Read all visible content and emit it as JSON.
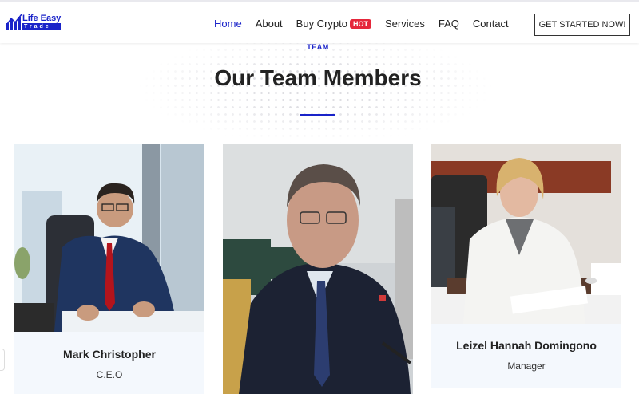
{
  "brand": {
    "line1": "Life Easy",
    "line2": "Trade",
    "color": "#1a23c9"
  },
  "nav": {
    "items": [
      {
        "label": "Home",
        "active": true
      },
      {
        "label": "About",
        "active": false
      },
      {
        "label": "Buy Crypto",
        "active": false,
        "badge": "HOT"
      },
      {
        "label": "Services",
        "active": false
      },
      {
        "label": "FAQ",
        "active": false
      },
      {
        "label": "Contact",
        "active": false
      }
    ],
    "cta": "GET STARTED NOW!"
  },
  "section": {
    "eyebrow": "TEAM",
    "title": "Our Team Members"
  },
  "team": [
    {
      "name": "Mark Christopher",
      "role": "C.E.O"
    },
    {
      "name": "",
      "role": ""
    },
    {
      "name": "Leizel Hannah Domingono",
      "role": "Manager"
    }
  ],
  "colors": {
    "accent": "#1a23c9",
    "hot_badge": "#e5273b",
    "card_bg": "#f4f8fd"
  }
}
